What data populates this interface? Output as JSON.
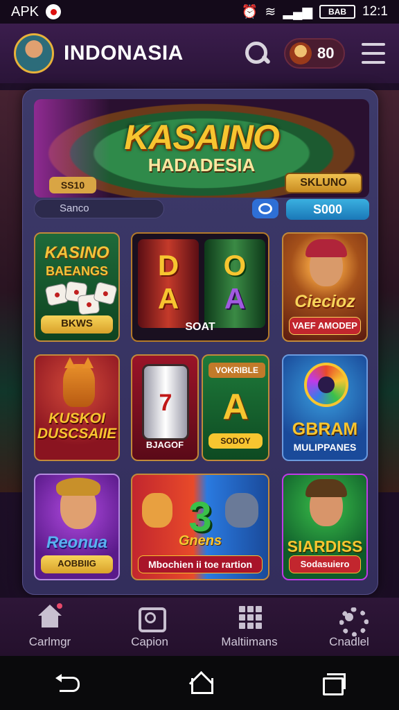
{
  "status_bar": {
    "carrier": "APK",
    "time": "12:1",
    "battery": "BAB"
  },
  "header": {
    "title": "INDONASIA",
    "coins": "80"
  },
  "banner": {
    "title": "KASAINO",
    "subtitle": "HADADESIA",
    "chip_left": "SS10",
    "chip_right": "SKLUNO"
  },
  "search": {
    "placeholder": "Sanco",
    "badge": "S000"
  },
  "tiles": [
    {
      "title": "KASINO",
      "subtitle": "BAEANGS",
      "button": "BKWS"
    },
    {
      "symbol_left": "D",
      "symbol_left2": "A",
      "symbol_right": "O",
      "symbol_right2": "A",
      "label": "SOAT"
    },
    {
      "title": "Ciecioz",
      "button": "VAEF AMODEP"
    },
    {
      "title": "KUSKOI DUSCSAIIE"
    },
    {
      "symbol": "7",
      "label": "BJAGOF"
    },
    {
      "top": "VOKRIBLE",
      "big": "A",
      "button": "SODOY"
    },
    {
      "title": "GBRAM",
      "subtitle": "MULIPPANES"
    },
    {
      "title": "Reonua",
      "button": "AOBBIIG"
    },
    {
      "big": "3",
      "script": "Gnens",
      "button": "Mbochien ii toe rartion"
    },
    {
      "title": "SIARDISS",
      "button": "Sodasuiero"
    }
  ],
  "nav": [
    {
      "label": "Carlmgr",
      "icon": "home-icon"
    },
    {
      "label": "Capion",
      "icon": "camera-icon"
    },
    {
      "label": "Maltiimans",
      "icon": "grid-icon"
    },
    {
      "label": "Cnadlel",
      "icon": "gear-icon"
    }
  ]
}
